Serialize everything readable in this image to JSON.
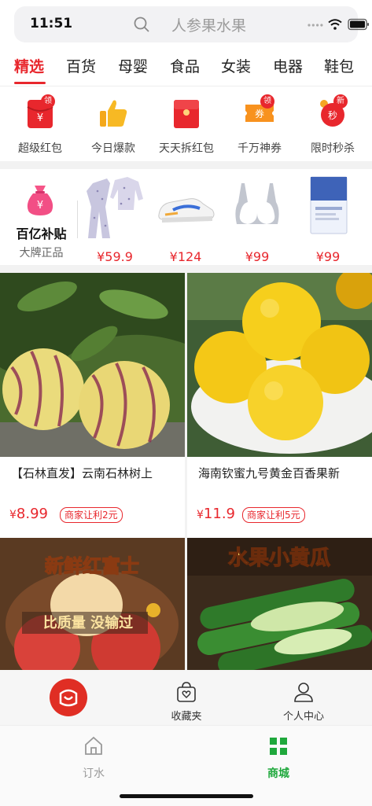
{
  "status": {
    "time": "11:51"
  },
  "search": {
    "placeholder": "人参果水果"
  },
  "tabs": [
    {
      "label": "精选",
      "active": true
    },
    {
      "label": "百货"
    },
    {
      "label": "母婴"
    },
    {
      "label": "食品"
    },
    {
      "label": "女装"
    },
    {
      "label": "电器"
    },
    {
      "label": "鞋包"
    }
  ],
  "shortcuts": [
    {
      "label": "超级红包",
      "icon": "red-envelope-icon",
      "badge": "领"
    },
    {
      "label": "今日爆款",
      "icon": "thumbs-up-icon",
      "badge": ""
    },
    {
      "label": "天天拆红包",
      "icon": "red-packet-icon",
      "badge": ""
    },
    {
      "label": "千万神券",
      "icon": "coupon-icon",
      "badge": "领",
      "icon_text": "券"
    },
    {
      "label": "限时秒杀",
      "icon": "alarm-clock-icon",
      "badge": "新",
      "icon_text": "秒"
    }
  ],
  "subsidy": {
    "title": "百亿补贴",
    "subtitle": "大牌正品",
    "products": [
      {
        "price": "¥59.9",
        "icon": "pajamas-image"
      },
      {
        "price": "¥124",
        "icon": "sneaker-image"
      },
      {
        "price": "¥99",
        "icon": "bra-image"
      },
      {
        "price": "¥99",
        "icon": "facial-mask-image"
      }
    ]
  },
  "products": [
    {
      "title": "【石林直发】云南石林树上",
      "price": "8.99",
      "tag": "商家让利2元",
      "image": "pepino-melon-image"
    },
    {
      "title": "海南钦蜜九号黄金百香果新",
      "price": "11.9",
      "tag": "商家让利5元",
      "image": "yellow-passion-fruit-image"
    },
    {
      "banner_title": "新鲜红富士",
      "banner_sub": "比质量 没输过",
      "image": "red-fuji-apple-image"
    },
    {
      "banner_title": "水果小黄瓜",
      "image": "cucumber-image"
    }
  ],
  "midbar": {
    "logo": "pinduoduo-logo",
    "items": [
      {
        "label": "收藏夹",
        "icon": "bag-heart-icon"
      },
      {
        "label": "个人中心",
        "icon": "user-icon"
      }
    ]
  },
  "bottom_nav": [
    {
      "label": "订水",
      "icon": "home-icon",
      "active": false
    },
    {
      "label": "商城",
      "icon": "grid-icon",
      "active": true
    }
  ],
  "colors": {
    "accent": "#e8272d",
    "nav_active": "#1fa83c"
  },
  "yen": "¥"
}
